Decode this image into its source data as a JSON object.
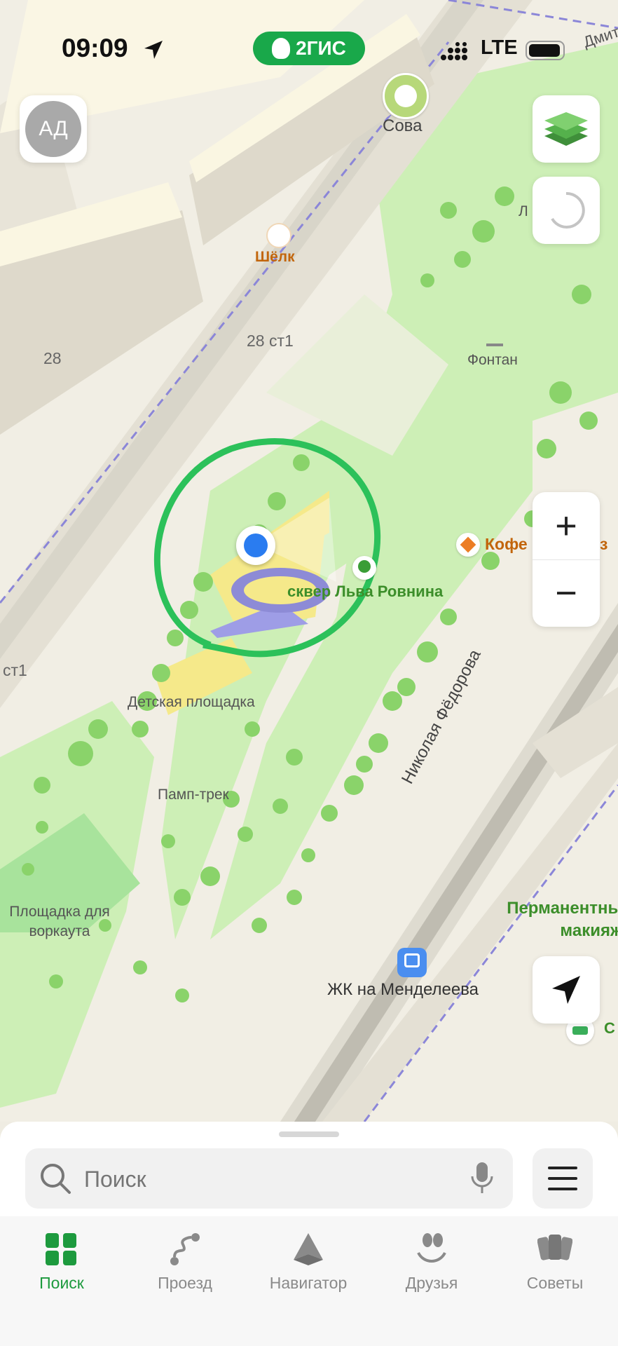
{
  "status_bar": {
    "time": "09:09",
    "network": "LTE"
  },
  "brand": {
    "name": "2ГИС"
  },
  "user": {
    "initials": "АД"
  },
  "map": {
    "streets": [
      "Дмит",
      "Николая Фёдорова"
    ],
    "labels": {
      "sova": "Сова",
      "shelk": "Шёлк",
      "fontan": "Фонтан",
      "bld_28": "28",
      "bld_28st1": "28 ст1",
      "st1": "ст1",
      "square": "сквер Льва Ровнина",
      "coffee": "Кофе",
      "coffee_tail": "з",
      "playground": "Детская площадка",
      "pump": "Памп-трек",
      "workout": "Площадка для воркаута",
      "permanent": "Перманентны макияж",
      "bus_stop": "ЖК на Менделеева",
      "hotel": "С",
      "partial_top": "Л"
    },
    "colors": {
      "park": "#c9efb0",
      "road": "#d9d7cd",
      "building": "#faf6e4",
      "accent": "#1fb45a",
      "location": "#2a7cf0"
    }
  },
  "controls": {
    "layers_icon": "layers-icon",
    "loading_icon": "loading-spinner-icon",
    "zoom_in": "+",
    "zoom_out": "−",
    "locate_icon": "navigation-arrow-icon"
  },
  "search": {
    "placeholder": "Поиск"
  },
  "tabs": [
    {
      "label": "Поиск",
      "icon": "grid-icon",
      "active": true
    },
    {
      "label": "Проезд",
      "icon": "route-icon",
      "active": false
    },
    {
      "label": "Навигатор",
      "icon": "navigator-icon",
      "active": false
    },
    {
      "label": "Друзья",
      "icon": "friends-icon",
      "active": false
    },
    {
      "label": "Советы",
      "icon": "tips-icon",
      "active": false
    }
  ]
}
